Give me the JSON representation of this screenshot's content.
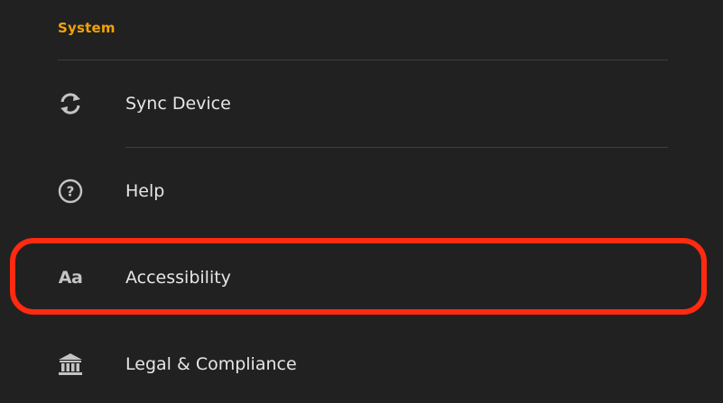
{
  "section": {
    "title": "System"
  },
  "items": [
    {
      "label": "Sync Device",
      "icon": "sync-icon"
    },
    {
      "label": "Help",
      "icon": "help-circle-icon"
    },
    {
      "label": "Accessibility",
      "icon": "text-size-icon",
      "icon_text": "Aa"
    },
    {
      "label": "Legal & Compliance",
      "icon": "bank-icon"
    }
  ],
  "colors": {
    "background": "#212121",
    "section_title": "#f0a30a",
    "highlight": "#ff2a10",
    "text": "#e6e6e6",
    "icon": "#c4c4c4",
    "divider": "#3e3e3e"
  }
}
